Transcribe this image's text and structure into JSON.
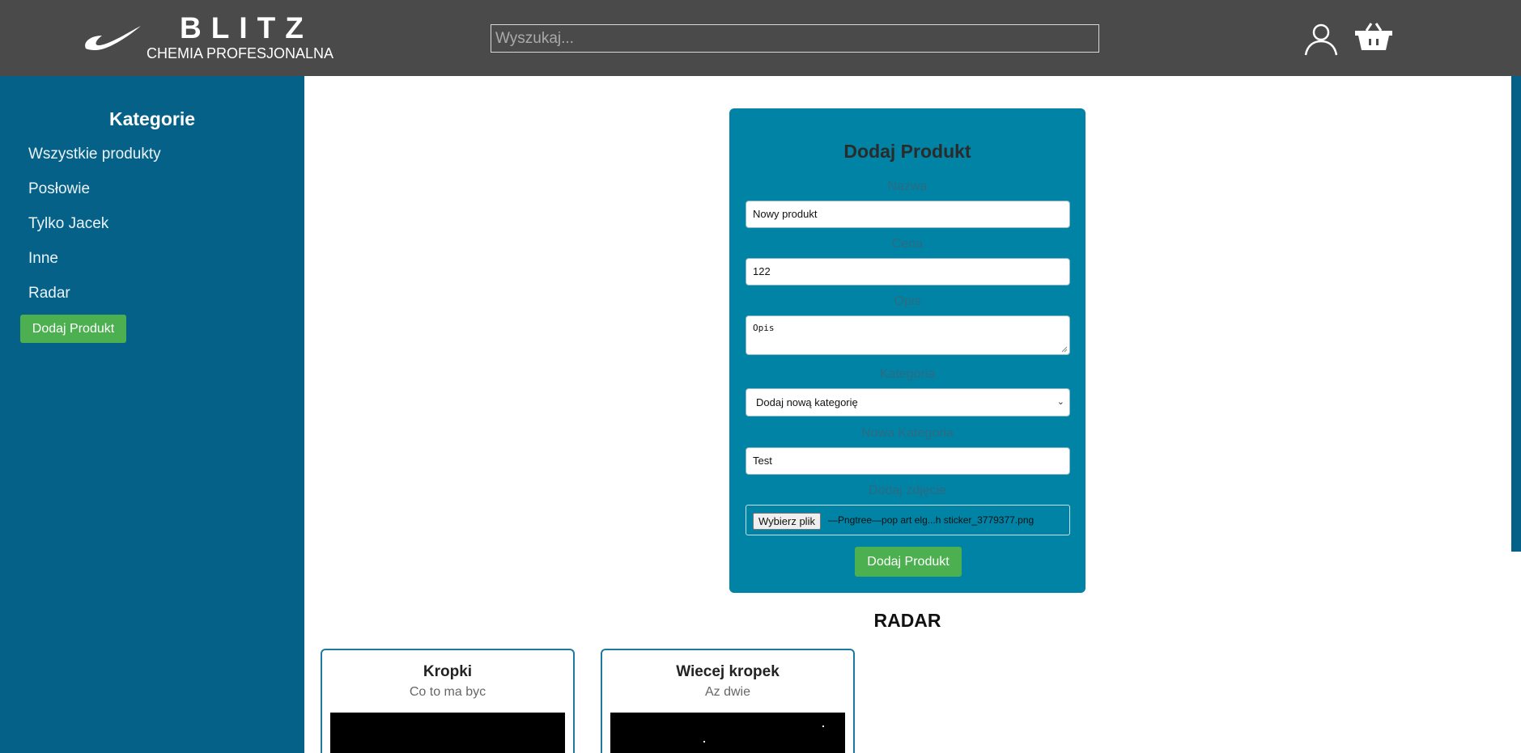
{
  "header": {
    "brand_title": "BLITZ",
    "brand_subtitle": "CHEMIA PROFESJONALNA",
    "search_placeholder": "Wyszukaj...",
    "logo_icon": "swoosh-logo",
    "user_icon": "user-icon",
    "cart_icon": "cart-icon"
  },
  "sidebar": {
    "title": "Kategorie",
    "items": [
      {
        "label": "Wszystkie produkty"
      },
      {
        "label": "Posłowie"
      },
      {
        "label": "Tylko Jacek"
      },
      {
        "label": "Inne"
      },
      {
        "label": "Radar"
      }
    ],
    "add_button": "Dodaj Produkt"
  },
  "form": {
    "title": "Dodaj Produkt",
    "name_label": "Nazwa",
    "name_value": "Nowy produkt",
    "price_label": "Cena",
    "price_value": "122",
    "desc_label": "Opis",
    "desc_value": "Opis",
    "category_label": "Kategoria",
    "category_value": "Dodaj nową kategorię",
    "new_category_label": "Nowa Kategoria",
    "new_category_value": "Test",
    "image_label": "Dodaj zdjęcie",
    "file_button": "Wybierz plik",
    "file_name": "—Pngtree—pop art elg...h sticker_3779377.png",
    "submit": "Dodaj Produkt"
  },
  "section": {
    "title": "RADAR"
  },
  "products": [
    {
      "name": "Kropki",
      "description": "Co to ma byc"
    },
    {
      "name": "Wiecej kropek",
      "description": "Az dwie"
    }
  ],
  "colors": {
    "header_bg": "#4a4a4a",
    "sidebar_bg": "#066188",
    "card_bg": "#0083a5",
    "accent_green": "#4caf50"
  }
}
